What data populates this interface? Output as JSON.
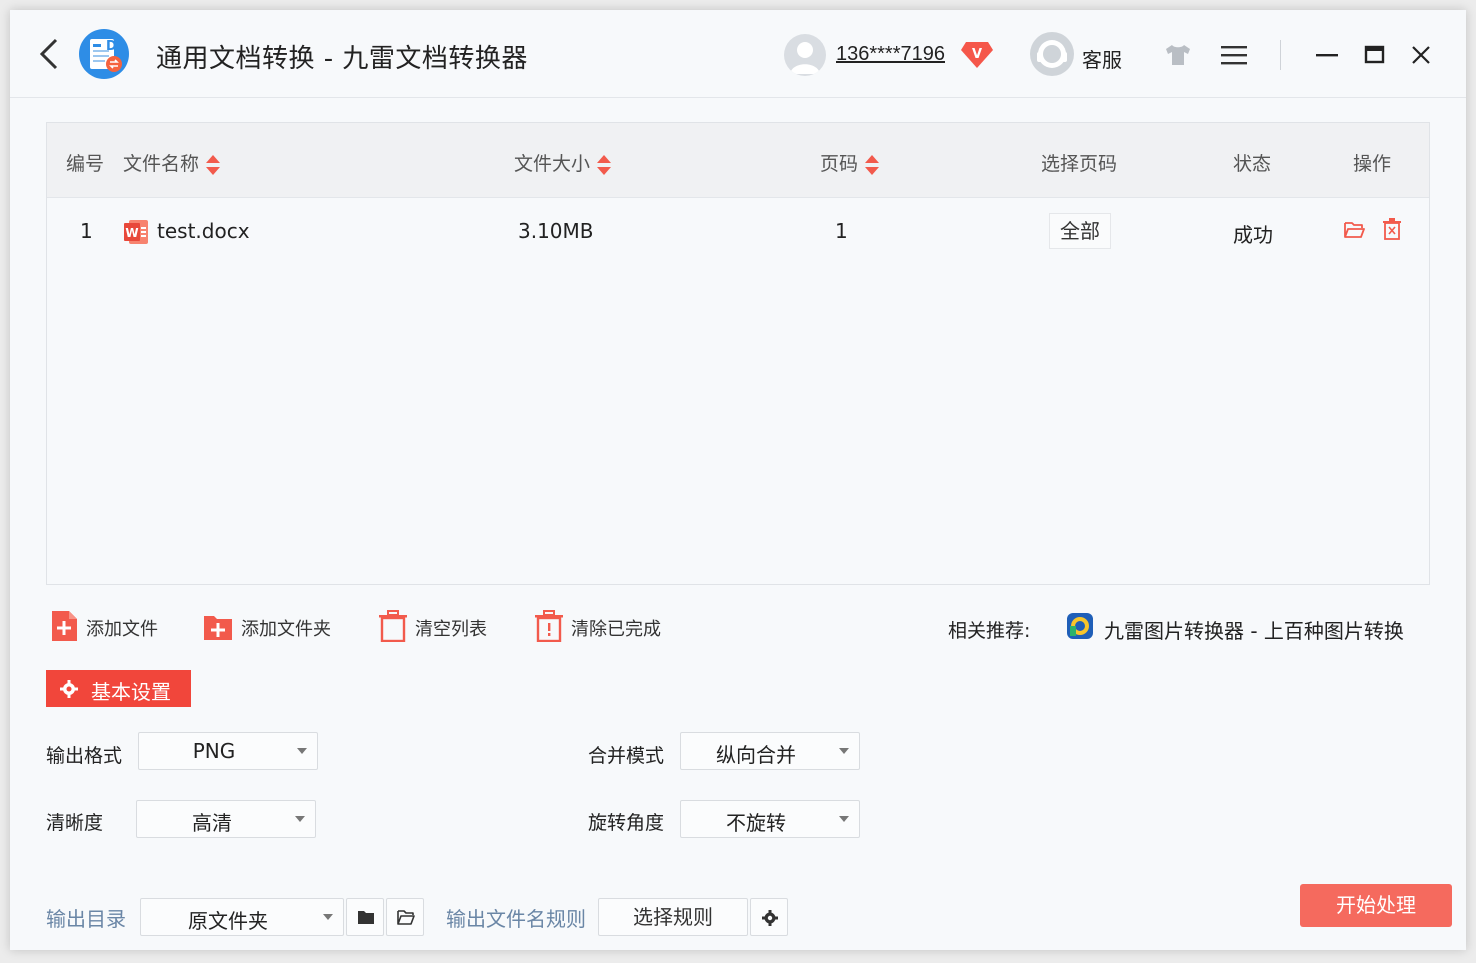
{
  "titlebar": {
    "title": "通用文档转换 - 九雷文档转换器",
    "user_phone": "136****7196",
    "vip_badge": "V",
    "customer_service": "客服"
  },
  "table": {
    "headers": {
      "index": "编号",
      "name": "文件名称",
      "size": "文件大小",
      "pages": "页码",
      "page_select": "选择页码",
      "status": "状态",
      "actions": "操作"
    },
    "rows": [
      {
        "index": "1",
        "name": "test.docx",
        "size": "3.10MB",
        "pages": "1",
        "page_select": "全部",
        "status": "成功"
      }
    ]
  },
  "actions": {
    "add_file": "添加文件",
    "add_folder": "添加文件夹",
    "clear_list": "清空列表",
    "clear_done": "清除已完成",
    "recommend_label": "相关推荐:",
    "recommend_text": "九雷图片转换器 - 上百种图片转换"
  },
  "settings": {
    "tab_label": "基本设置",
    "output_format_label": "输出格式",
    "output_format_value": "PNG",
    "merge_mode_label": "合并模式",
    "merge_mode_value": "纵向合并",
    "clarity_label": "清晰度",
    "clarity_value": "高清",
    "rotation_label": "旋转角度",
    "rotation_value": "不旋转",
    "output_dir_label": "输出目录",
    "output_dir_value": "原文件夹",
    "filename_rule_label": "输出文件名规则",
    "filename_rule_button": "选择规则",
    "start_button": "开始处理"
  },
  "colors": {
    "accent_red": "#f1463b",
    "start_button": "#f56a5e",
    "label_blue": "#6a86a6"
  }
}
